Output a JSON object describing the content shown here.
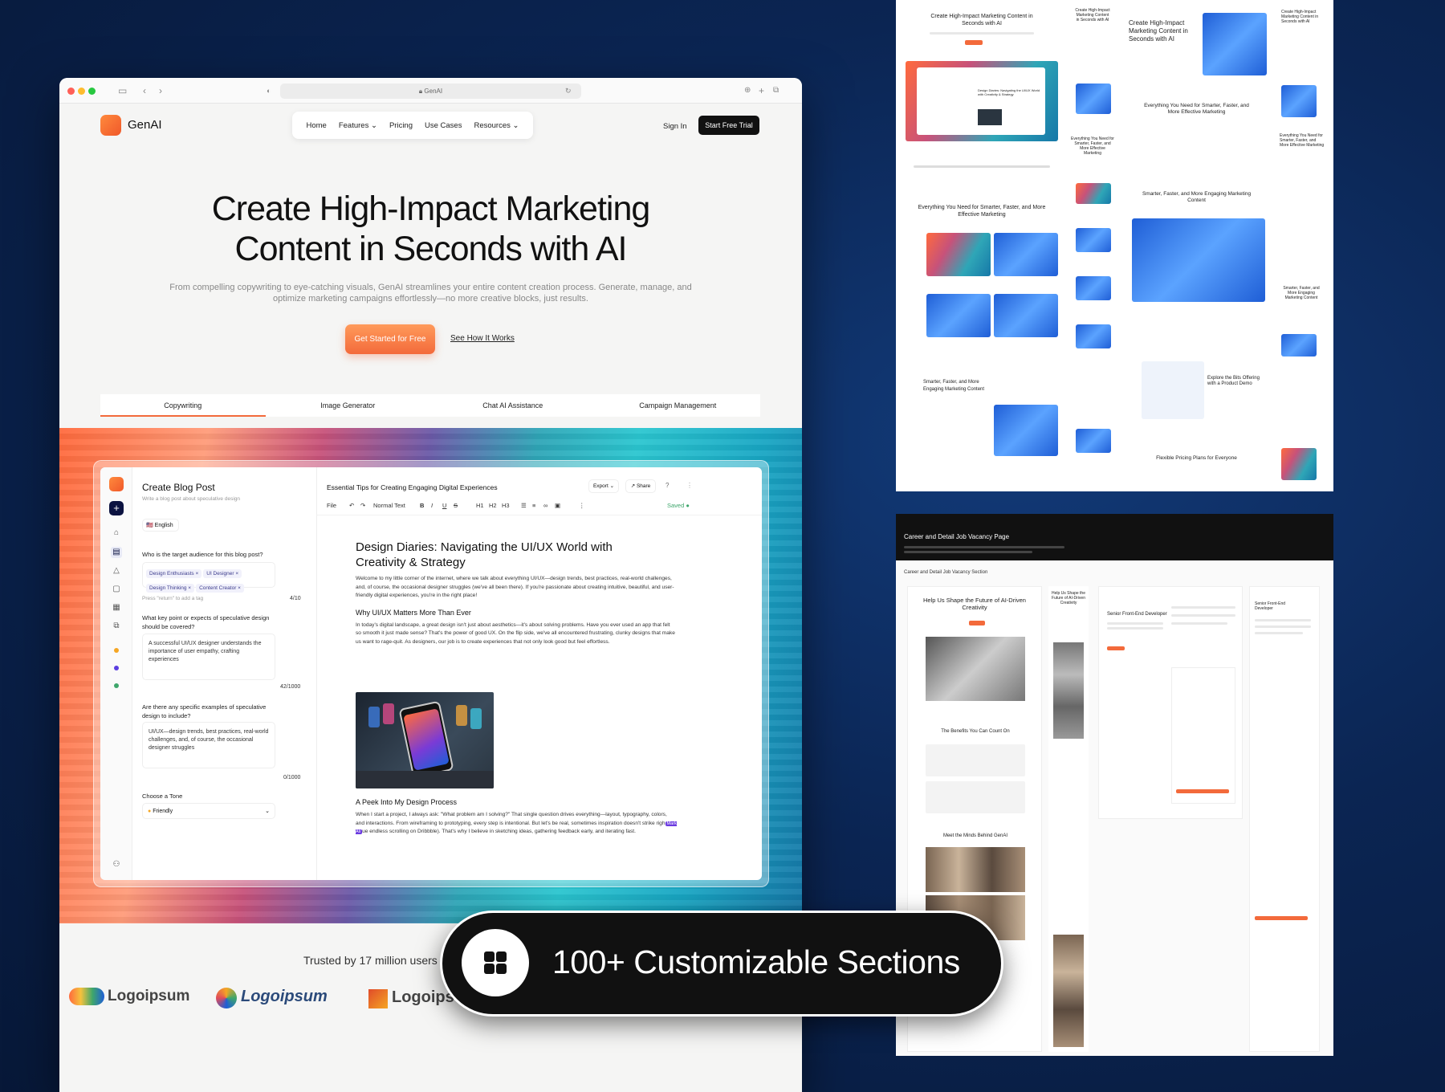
{
  "browser": {
    "address": "GenAI",
    "brand": "GenAI",
    "nav": [
      "Home",
      "Features",
      "Pricing",
      "Use Cases",
      "Resources"
    ],
    "sign_in": "Sign In",
    "trial_button": "Start Free Trial",
    "hero_title": "Create High-Impact Marketing Content in Seconds with AI",
    "hero_subtitle": "From compelling copywriting to eye-catching visuals, GenAI streamlines your entire content creation process. Generate, manage, and optimize marketing campaigns effortlessly—no more creative blocks, just results.",
    "cta_primary": "Get Started for Free",
    "cta_secondary": "See How It Works",
    "tabs": [
      "Copywriting",
      "Image Generator",
      "Chat AI Assistance",
      "Campaign Management"
    ],
    "active_tab": "Copywriting",
    "trusted": "Trusted by 17 million users",
    "logos": [
      "Logoipsum",
      "Logoipsum",
      "Logoips"
    ],
    "colors": {
      "accent": "#f36a3b",
      "dark": "#111111"
    }
  },
  "editor": {
    "title": "Create Blog Post",
    "subtitle": "Write a blog post about speculative design",
    "language": "English",
    "q1": "Who is the target audience for this blog post?",
    "q1_tags": [
      "Design Enthusiasts",
      "UI Designer",
      "Design Thinking",
      "Content Creator"
    ],
    "q1_hint": "Press \"return\" to add a tag",
    "q1_count": "4/10",
    "q2": "What key point or expects of speculative design should be covered?",
    "q2_answer": "A successful UI/UX designer understands the importance of user empathy, crafting experiences",
    "q2_count": "42/1000",
    "q3": "Are there any specific examples of speculative design to include?",
    "q3_answer": "UI/UX—design trends, best practices, real-world challenges, and, of course, the occasional designer struggles",
    "q3_count": "0/1000",
    "tone_label": "Choose a Tone",
    "tone_value": "Friendly",
    "doc_title": "Essential Tips for Creating Engaging Digital Experiences",
    "export": "Export",
    "share": "Share",
    "toolbar": {
      "file": "File",
      "style": "Normal Text",
      "h1": "H1",
      "h2": "H2",
      "h3": "H3",
      "saved": "Saved"
    },
    "heading": "Design Diaries: Navigating the UI/UX World with Creativity & Strategy",
    "para1": "Welcome to my little corner of the internet, where we talk about everything UI/UX—design trends, best practices, real-world challenges, and, of course, the occasional designer struggles (we've all been there). If you're passionate about creating intuitive, beautiful, and user-friendly digital experiences, you're in the right place!",
    "h_why": "Why UI/UX Matters More Than Ever",
    "para2": "In today's digital landscape, a great design isn't just about aesthetics—it's about solving problems. Have you ever used an app that felt so smooth it just made sense? That's the power of good UX. On the flip side, we've all encountered frustrating, clunky designs that make us want to rage-quit. As designers, our job is to create experiences that not only look good but feel effortless.",
    "h_peek": "A Peek Into My Design Process",
    "para3a": "When I start a project, I always ask: \"What problem am I solving?\" That single question drives everything—layout, typography, colors, and interactions. From wireframing to prototyping, every step is intentional. But let's be real, sometimes inspiration doesn't strike righ",
    "mark_tag": "Mark Ali",
    "para3b": "ue endless scrolling on Dribbble). That's why I believe in sketching ideas, gathering feedback early, and iterating fast."
  },
  "panel_top": {
    "hero1": "Create High-Impact Marketing Content in Seconds with AI",
    "hero2": "Create High-Impact Marketing Content in Seconds with AI",
    "hero3": "Create High-Impact Marketing Content in Seconds with AI",
    "features1": "Everything You Need for Smarter, Faster, and More Effective Marketing",
    "features2": "Everything You Need for Smarter, Faster, and More Effective Marketing",
    "smarter1": "Smarter, Faster, and More Engaging Marketing Content",
    "smarter2": "Smarter, Faster, and More Engaging Marketing Content",
    "explore": "Explore the Bits Offering with a Product Demo",
    "pricing": "Flexible Pricing Plans for Everyone",
    "doc_heading": "Design Diaries: Navigating the UI/UX World with Creativity & Strategy"
  },
  "panel_bottom": {
    "header": "Career and Detail Job Vacancy Page",
    "section": "Career and Detail Job Vacancy Section",
    "shape": "Help Us Shape the Future of AI-Driven Creativity",
    "benefits": "The Benefits You Can Count On",
    "minds": "Meet the Minds Behind GenAI",
    "role": "Senior Front-End Developer"
  },
  "badge": {
    "text": "100+ Customizable Sections",
    "icon": "grid-icon"
  }
}
